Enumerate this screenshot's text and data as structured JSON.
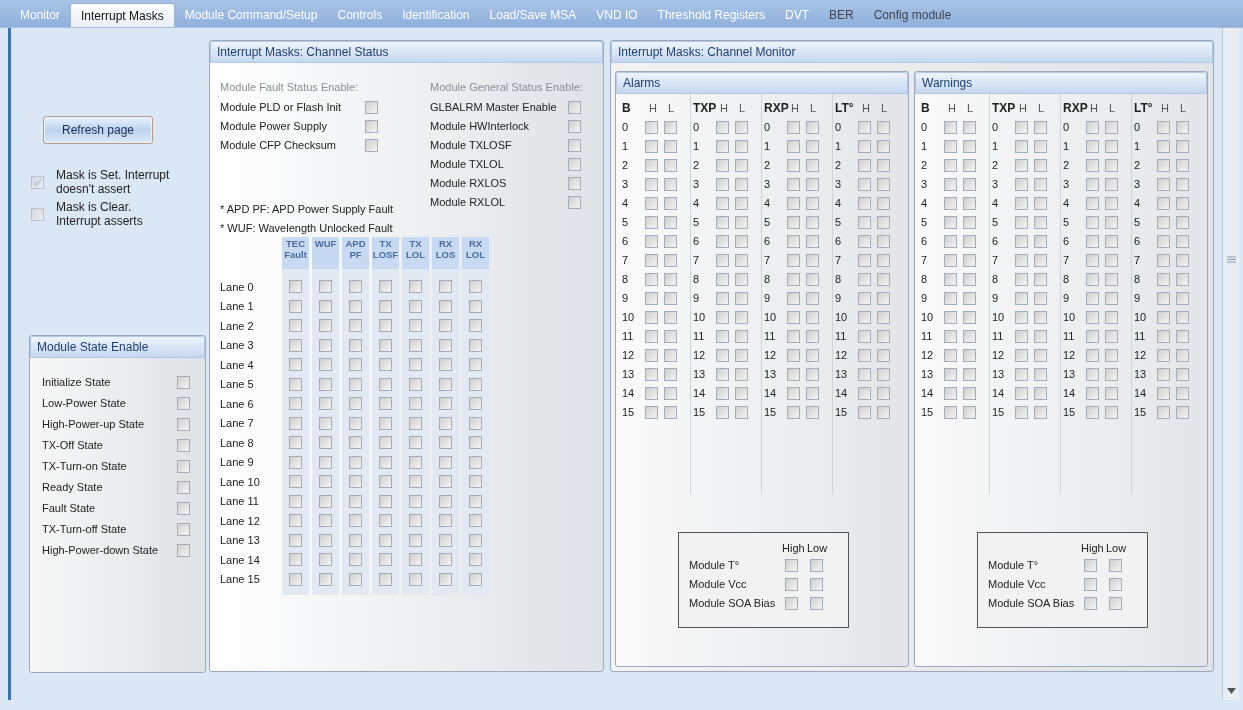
{
  "tabs": [
    {
      "label": "Monitor",
      "selected": false,
      "disabled": true
    },
    {
      "label": "Interrupt Masks",
      "selected": true,
      "disabled": false
    },
    {
      "label": "Module Command/Setup",
      "selected": false,
      "disabled": true
    },
    {
      "label": "Controls",
      "selected": false,
      "disabled": true
    },
    {
      "label": "Identification",
      "selected": false,
      "disabled": true
    },
    {
      "label": "Load/Save MSA",
      "selected": false,
      "disabled": true
    },
    {
      "label": "VND IO",
      "selected": false,
      "disabled": true
    },
    {
      "label": "Threshold Registers",
      "selected": false,
      "disabled": true
    },
    {
      "label": "DVT",
      "selected": false,
      "disabled": true
    },
    {
      "label": "BER",
      "selected": false,
      "disabled": false
    },
    {
      "label": "Config module",
      "selected": false,
      "disabled": false
    }
  ],
  "refresh_button": "Refresh page",
  "legend": [
    {
      "label": "Mask is Set. Interrupt doesn't assert",
      "checked": true
    },
    {
      "label": "Mask is Clear. Interrupt asserts",
      "checked": false
    }
  ],
  "module_state_enable": {
    "title": "Module State Enable",
    "items": [
      {
        "label": "Initialize State",
        "checked": false
      },
      {
        "label": "Low-Power State",
        "checked": false
      },
      {
        "label": "High-Power-up State",
        "checked": false
      },
      {
        "label": "TX-Off State",
        "checked": false
      },
      {
        "label": "TX-Turn-on State",
        "checked": false
      },
      {
        "label": "Ready State",
        "checked": false
      },
      {
        "label": "Fault State",
        "checked": false
      },
      {
        "label": "TX-Turn-off State",
        "checked": false
      },
      {
        "label": "High-Power-down State",
        "checked": false
      }
    ]
  },
  "channel_status": {
    "title": "Interrupt Masks: Channel Status",
    "fault_heading": "Module Fault Status Enable:",
    "fault_items": [
      {
        "label": "Module PLD or Flash Init",
        "checked": false
      },
      {
        "label": "Module Power Supply",
        "checked": false
      },
      {
        "label": "Module CFP Checksum",
        "checked": false
      }
    ],
    "general_heading": "Module General Status Enable:",
    "general_items": [
      {
        "label": "GLBALRM Master Enable",
        "checked": false
      },
      {
        "label": "Module HWInterlock",
        "checked": false
      },
      {
        "label": "Module TXLOSF",
        "checked": false
      },
      {
        "label": "Module TXLOL",
        "checked": false
      },
      {
        "label": "Module RXLOS",
        "checked": false
      },
      {
        "label": "Module RXLOL",
        "checked": false
      }
    ],
    "notes": [
      "* APD PF: APD Power Supply Fault",
      "* WUF: Wavelength Unlocked Fault"
    ],
    "columns": [
      "TEC Fault",
      "WUF",
      "APD PF",
      "TX LOSF",
      "TX LOL",
      "RX LOS",
      "RX LOL"
    ],
    "lanes": [
      {
        "label": "Lane 0",
        "checked": [
          false,
          false,
          false,
          false,
          false,
          false,
          false
        ]
      },
      {
        "label": "Lane 1",
        "checked": [
          false,
          false,
          false,
          false,
          false,
          false,
          false
        ]
      },
      {
        "label": "Lane 2",
        "checked": [
          false,
          false,
          false,
          false,
          false,
          false,
          false
        ]
      },
      {
        "label": "Lane 3",
        "checked": [
          false,
          false,
          false,
          false,
          false,
          false,
          false
        ]
      },
      {
        "label": "Lane 4",
        "checked": [
          false,
          false,
          false,
          false,
          false,
          false,
          false
        ]
      },
      {
        "label": "Lane 5",
        "checked": [
          false,
          false,
          false,
          false,
          false,
          false,
          false
        ]
      },
      {
        "label": "Lane 6",
        "checked": [
          false,
          false,
          false,
          false,
          false,
          false,
          false
        ]
      },
      {
        "label": "Lane 7",
        "checked": [
          false,
          false,
          false,
          false,
          false,
          false,
          false
        ]
      },
      {
        "label": "Lane 8",
        "checked": [
          false,
          false,
          false,
          false,
          false,
          false,
          false
        ]
      },
      {
        "label": "Lane 9",
        "checked": [
          false,
          false,
          false,
          false,
          false,
          false,
          false
        ]
      },
      {
        "label": "Lane 10",
        "checked": [
          false,
          false,
          false,
          false,
          false,
          false,
          false
        ]
      },
      {
        "label": "Lane 11",
        "checked": [
          false,
          false,
          false,
          false,
          false,
          false,
          false
        ]
      },
      {
        "label": "Lane 12",
        "checked": [
          false,
          false,
          false,
          false,
          false,
          false,
          false
        ]
      },
      {
        "label": "Lane 13",
        "checked": [
          false,
          false,
          false,
          false,
          false,
          false,
          false
        ]
      },
      {
        "label": "Lane 14",
        "checked": [
          false,
          false,
          false,
          false,
          false,
          false,
          false
        ]
      },
      {
        "label": "Lane 15",
        "checked": [
          false,
          false,
          false,
          false,
          false,
          false,
          false
        ]
      }
    ]
  },
  "channel_monitor": {
    "title": "Interrupt Masks: Channel Monitor",
    "panels": [
      {
        "title": "Alarms",
        "groups": [
          {
            "label": "B",
            "high": "H",
            "low": "L",
            "rows": [
              {
                "label": "0",
                "checked": [
                  false,
                  false
                ]
              },
              {
                "label": "1",
                "checked": [
                  false,
                  false
                ]
              },
              {
                "label": "2",
                "checked": [
                  false,
                  false
                ]
              },
              {
                "label": "3",
                "checked": [
                  false,
                  false
                ]
              },
              {
                "label": "4",
                "checked": [
                  false,
                  false
                ]
              },
              {
                "label": "5",
                "checked": [
                  false,
                  false
                ]
              },
              {
                "label": "6",
                "checked": [
                  false,
                  false
                ]
              },
              {
                "label": "7",
                "checked": [
                  false,
                  false
                ]
              },
              {
                "label": "8",
                "checked": [
                  false,
                  false
                ]
              },
              {
                "label": "9",
                "checked": [
                  false,
                  false
                ]
              },
              {
                "label": "10",
                "checked": [
                  false,
                  false
                ]
              },
              {
                "label": "11",
                "checked": [
                  false,
                  false
                ]
              },
              {
                "label": "12",
                "checked": [
                  false,
                  false
                ]
              },
              {
                "label": "13",
                "checked": [
                  false,
                  false
                ]
              },
              {
                "label": "14",
                "checked": [
                  false,
                  false
                ]
              },
              {
                "label": "15",
                "checked": [
                  false,
                  false
                ]
              }
            ]
          },
          {
            "label": "TXP",
            "high": "H",
            "low": "L",
            "rows": [
              {
                "label": "0",
                "checked": [
                  false,
                  false
                ]
              },
              {
                "label": "1",
                "checked": [
                  false,
                  false
                ]
              },
              {
                "label": "2",
                "checked": [
                  false,
                  false
                ]
              },
              {
                "label": "3",
                "checked": [
                  false,
                  false
                ]
              },
              {
                "label": "4",
                "checked": [
                  false,
                  false
                ]
              },
              {
                "label": "5",
                "checked": [
                  false,
                  false
                ]
              },
              {
                "label": "6",
                "checked": [
                  false,
                  false
                ]
              },
              {
                "label": "7",
                "checked": [
                  false,
                  false
                ]
              },
              {
                "label": "8",
                "checked": [
                  false,
                  false
                ]
              },
              {
                "label": "9",
                "checked": [
                  false,
                  false
                ]
              },
              {
                "label": "10",
                "checked": [
                  false,
                  false
                ]
              },
              {
                "label": "11",
                "checked": [
                  false,
                  false
                ]
              },
              {
                "label": "12",
                "checked": [
                  false,
                  false
                ]
              },
              {
                "label": "13",
                "checked": [
                  false,
                  false
                ]
              },
              {
                "label": "14",
                "checked": [
                  false,
                  false
                ]
              },
              {
                "label": "15",
                "checked": [
                  false,
                  false
                ]
              }
            ]
          },
          {
            "label": "RXP",
            "high": "H",
            "low": "L",
            "rows": [
              {
                "label": "0",
                "checked": [
                  false,
                  false
                ]
              },
              {
                "label": "1",
                "checked": [
                  false,
                  false
                ]
              },
              {
                "label": "2",
                "checked": [
                  false,
                  false
                ]
              },
              {
                "label": "3",
                "checked": [
                  false,
                  false
                ]
              },
              {
                "label": "4",
                "checked": [
                  false,
                  false
                ]
              },
              {
                "label": "5",
                "checked": [
                  false,
                  false
                ]
              },
              {
                "label": "6",
                "checked": [
                  false,
                  false
                ]
              },
              {
                "label": "7",
                "checked": [
                  false,
                  false
                ]
              },
              {
                "label": "8",
                "checked": [
                  false,
                  false
                ]
              },
              {
                "label": "9",
                "checked": [
                  false,
                  false
                ]
              },
              {
                "label": "10",
                "checked": [
                  false,
                  false
                ]
              },
              {
                "label": "11",
                "checked": [
                  false,
                  false
                ]
              },
              {
                "label": "12",
                "checked": [
                  false,
                  false
                ]
              },
              {
                "label": "13",
                "checked": [
                  false,
                  false
                ]
              },
              {
                "label": "14",
                "checked": [
                  false,
                  false
                ]
              },
              {
                "label": "15",
                "checked": [
                  false,
                  false
                ]
              }
            ]
          },
          {
            "label": "LT°",
            "high": "H",
            "low": "L",
            "rows": [
              {
                "label": "0",
                "checked": [
                  false,
                  false
                ]
              },
              {
                "label": "1",
                "checked": [
                  false,
                  false
                ]
              },
              {
                "label": "2",
                "checked": [
                  false,
                  false
                ]
              },
              {
                "label": "3",
                "checked": [
                  false,
                  false
                ]
              },
              {
                "label": "4",
                "checked": [
                  false,
                  false
                ]
              },
              {
                "label": "5",
                "checked": [
                  false,
                  false
                ]
              },
              {
                "label": "6",
                "checked": [
                  false,
                  false
                ]
              },
              {
                "label": "7",
                "checked": [
                  false,
                  false
                ]
              },
              {
                "label": "8",
                "checked": [
                  false,
                  false
                ]
              },
              {
                "label": "9",
                "checked": [
                  false,
                  false
                ]
              },
              {
                "label": "10",
                "checked": [
                  false,
                  false
                ]
              },
              {
                "label": "11",
                "checked": [
                  false,
                  false
                ]
              },
              {
                "label": "12",
                "checked": [
                  false,
                  false
                ]
              },
              {
                "label": "13",
                "checked": [
                  false,
                  false
                ]
              },
              {
                "label": "14",
                "checked": [
                  false,
                  false
                ]
              },
              {
                "label": "15",
                "checked": [
                  false,
                  false
                ]
              }
            ]
          }
        ],
        "module_box": {
          "headers": [
            "High",
            "Low"
          ],
          "rows": [
            {
              "label": "Module T°",
              "checked": [
                false,
                false
              ]
            },
            {
              "label": "Module Vcc",
              "checked": [
                false,
                false
              ]
            },
            {
              "label": "Module SOA Bias",
              "checked": [
                false,
                false
              ]
            }
          ]
        }
      },
      {
        "title": "Warnings",
        "groups": [
          {
            "label": "B",
            "high": "H",
            "low": "L",
            "rows": [
              {
                "label": "0",
                "checked": [
                  false,
                  false
                ]
              },
              {
                "label": "1",
                "checked": [
                  false,
                  false
                ]
              },
              {
                "label": "2",
                "checked": [
                  false,
                  false
                ]
              },
              {
                "label": "3",
                "checked": [
                  false,
                  false
                ]
              },
              {
                "label": "4",
                "checked": [
                  false,
                  false
                ]
              },
              {
                "label": "5",
                "checked": [
                  false,
                  false
                ]
              },
              {
                "label": "6",
                "checked": [
                  false,
                  false
                ]
              },
              {
                "label": "7",
                "checked": [
                  false,
                  false
                ]
              },
              {
                "label": "8",
                "checked": [
                  false,
                  false
                ]
              },
              {
                "label": "9",
                "checked": [
                  false,
                  false
                ]
              },
              {
                "label": "10",
                "checked": [
                  false,
                  false
                ]
              },
              {
                "label": "11",
                "checked": [
                  false,
                  false
                ]
              },
              {
                "label": "12",
                "checked": [
                  false,
                  false
                ]
              },
              {
                "label": "13",
                "checked": [
                  false,
                  false
                ]
              },
              {
                "label": "14",
                "checked": [
                  false,
                  false
                ]
              },
              {
                "label": "15",
                "checked": [
                  false,
                  false
                ]
              }
            ]
          },
          {
            "label": "TXP",
            "high": "H",
            "low": "L",
            "rows": [
              {
                "label": "0",
                "checked": [
                  false,
                  false
                ]
              },
              {
                "label": "1",
                "checked": [
                  false,
                  false
                ]
              },
              {
                "label": "2",
                "checked": [
                  false,
                  false
                ]
              },
              {
                "label": "3",
                "checked": [
                  false,
                  false
                ]
              },
              {
                "label": "4",
                "checked": [
                  false,
                  false
                ]
              },
              {
                "label": "5",
                "checked": [
                  false,
                  false
                ]
              },
              {
                "label": "6",
                "checked": [
                  false,
                  false
                ]
              },
              {
                "label": "7",
                "checked": [
                  false,
                  false
                ]
              },
              {
                "label": "8",
                "checked": [
                  false,
                  false
                ]
              },
              {
                "label": "9",
                "checked": [
                  false,
                  false
                ]
              },
              {
                "label": "10",
                "checked": [
                  false,
                  false
                ]
              },
              {
                "label": "11",
                "checked": [
                  false,
                  false
                ]
              },
              {
                "label": "12",
                "checked": [
                  false,
                  false
                ]
              },
              {
                "label": "13",
                "checked": [
                  false,
                  false
                ]
              },
              {
                "label": "14",
                "checked": [
                  false,
                  false
                ]
              },
              {
                "label": "15",
                "checked": [
                  false,
                  false
                ]
              }
            ]
          },
          {
            "label": "RXP",
            "high": "H",
            "low": "L",
            "rows": [
              {
                "label": "0",
                "checked": [
                  false,
                  false
                ]
              },
              {
                "label": "1",
                "checked": [
                  false,
                  false
                ]
              },
              {
                "label": "2",
                "checked": [
                  false,
                  false
                ]
              },
              {
                "label": "3",
                "checked": [
                  false,
                  false
                ]
              },
              {
                "label": "4",
                "checked": [
                  false,
                  false
                ]
              },
              {
                "label": "5",
                "checked": [
                  false,
                  false
                ]
              },
              {
                "label": "6",
                "checked": [
                  false,
                  false
                ]
              },
              {
                "label": "7",
                "checked": [
                  false,
                  false
                ]
              },
              {
                "label": "8",
                "checked": [
                  false,
                  false
                ]
              },
              {
                "label": "9",
                "checked": [
                  false,
                  false
                ]
              },
              {
                "label": "10",
                "checked": [
                  false,
                  false
                ]
              },
              {
                "label": "11",
                "checked": [
                  false,
                  false
                ]
              },
              {
                "label": "12",
                "checked": [
                  false,
                  false
                ]
              },
              {
                "label": "13",
                "checked": [
                  false,
                  false
                ]
              },
              {
                "label": "14",
                "checked": [
                  false,
                  false
                ]
              },
              {
                "label": "15",
                "checked": [
                  false,
                  false
                ]
              }
            ]
          },
          {
            "label": "LT°",
            "high": "H",
            "low": "L",
            "rows": [
              {
                "label": "0",
                "checked": [
                  false,
                  false
                ]
              },
              {
                "label": "1",
                "checked": [
                  false,
                  false
                ]
              },
              {
                "label": "2",
                "checked": [
                  false,
                  false
                ]
              },
              {
                "label": "3",
                "checked": [
                  false,
                  false
                ]
              },
              {
                "label": "4",
                "checked": [
                  false,
                  false
                ]
              },
              {
                "label": "5",
                "checked": [
                  false,
                  false
                ]
              },
              {
                "label": "6",
                "checked": [
                  false,
                  false
                ]
              },
              {
                "label": "7",
                "checked": [
                  false,
                  false
                ]
              },
              {
                "label": "8",
                "checked": [
                  false,
                  false
                ]
              },
              {
                "label": "9",
                "checked": [
                  false,
                  false
                ]
              },
              {
                "label": "10",
                "checked": [
                  false,
                  false
                ]
              },
              {
                "label": "11",
                "checked": [
                  false,
                  false
                ]
              },
              {
                "label": "12",
                "checked": [
                  false,
                  false
                ]
              },
              {
                "label": "13",
                "checked": [
                  false,
                  false
                ]
              },
              {
                "label": "14",
                "checked": [
                  false,
                  false
                ]
              },
              {
                "label": "15",
                "checked": [
                  false,
                  false
                ]
              }
            ]
          }
        ],
        "module_box": {
          "headers": [
            "High",
            "Low"
          ],
          "rows": [
            {
              "label": "Module T°",
              "checked": [
                false,
                false
              ]
            },
            {
              "label": "Module Vcc",
              "checked": [
                false,
                false
              ]
            },
            {
              "label": "Module SOA Bias",
              "checked": [
                false,
                false
              ]
            }
          ]
        }
      }
    ]
  }
}
